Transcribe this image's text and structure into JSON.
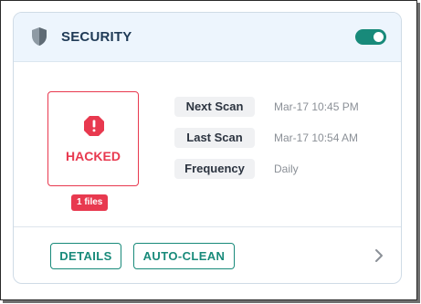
{
  "card": {
    "title": "SECURITY",
    "toggle_enabled": true,
    "header_icon": "shield-icon"
  },
  "status": {
    "label": "HACKED",
    "icon": "alert-octagon-icon",
    "files_badge": "1 files"
  },
  "info": [
    {
      "key": "Next Scan",
      "value": "Mar-17 10:45 PM"
    },
    {
      "key": "Last Scan",
      "value": "Mar-17 10:54 AM"
    },
    {
      "key": "Frequency",
      "value": "Daily"
    }
  ],
  "actions": {
    "details_label": "DETAILS",
    "autoclean_label": "AUTO-CLEAN",
    "more_icon": "chevron-right-icon"
  },
  "colors": {
    "accent": "#188a7a",
    "danger": "#e8394f",
    "header_bg": "#edf5fd",
    "title": "#1f3a56"
  }
}
